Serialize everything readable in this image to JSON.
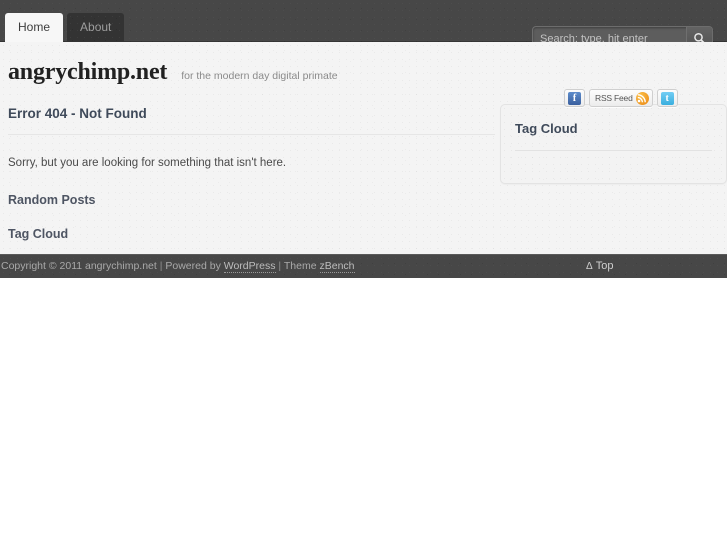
{
  "nav": {
    "tabs": [
      {
        "label": "Home",
        "active": true
      },
      {
        "label": "About",
        "active": false
      }
    ]
  },
  "search": {
    "placeholder": "Search: type, hit enter",
    "value": "",
    "icon": "search-icon",
    "button_label": ""
  },
  "brand": {
    "site_title": "angrychimp.net",
    "tagline": "for the modern day digital primate"
  },
  "main": {
    "error_title": "Error 404 - Not Found",
    "error_message": "Sorry, but you are looking for something that isn't here.",
    "sections": [
      {
        "title": "Random Posts"
      },
      {
        "title": "Tag Cloud"
      }
    ]
  },
  "sidebar": {
    "social": [
      {
        "name": "facebook-icon",
        "label": "",
        "glyph": "f"
      },
      {
        "name": "rss-icon",
        "label": "RSS Feed",
        "glyph": ""
      },
      {
        "name": "twitter-icon",
        "label": "",
        "glyph": "t"
      }
    ],
    "widget": {
      "title": "Tag Cloud"
    }
  },
  "footer": {
    "copyright_prefix": "Copyright © 2011 angrychimp.net",
    "sep1": " | ",
    "powered_prefix": "Powered by ",
    "powered_link": "WordPress",
    "sep2": " | ",
    "theme_prefix": "Theme ",
    "theme_link": "zBench",
    "top_triangle": "Δ",
    "top_label": "Top"
  },
  "colors": {
    "bar_dark": "#474747",
    "tab_active_bg": "#f7f7f7",
    "page_bg": "#f4f4f4",
    "heading": "#3f4a5a",
    "facebook": "#3a5f9e",
    "twitter": "#3aaede",
    "rss": "#e98310"
  }
}
